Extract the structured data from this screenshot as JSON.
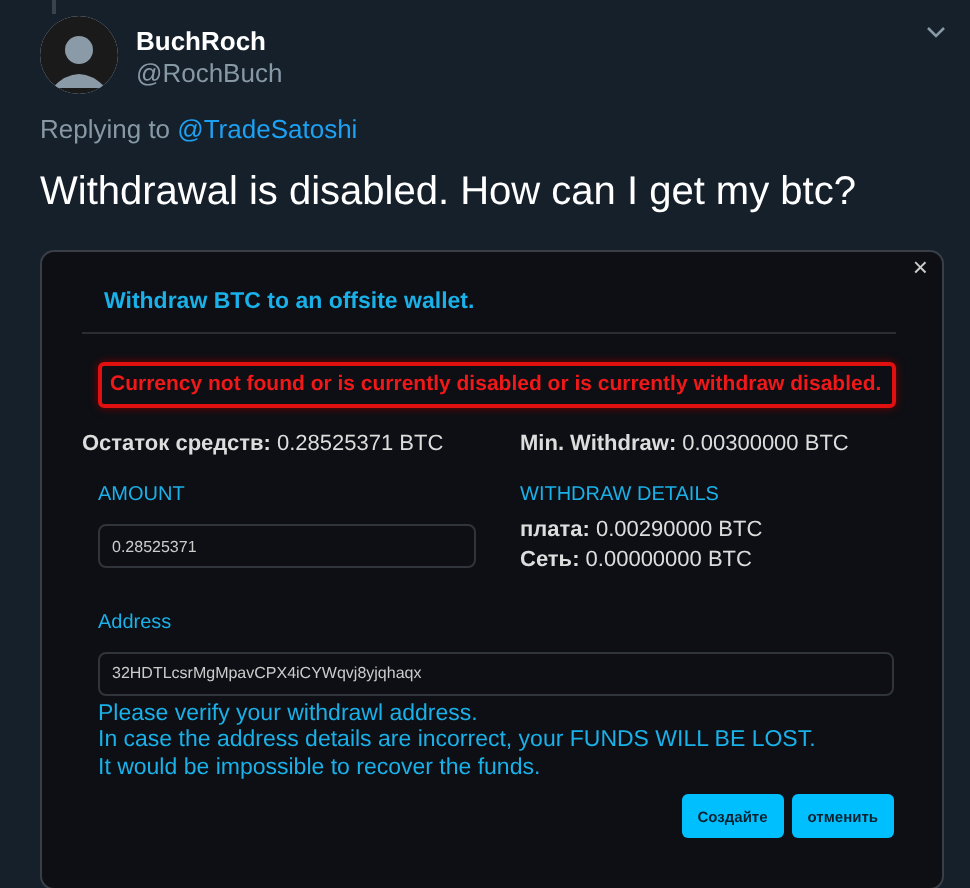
{
  "tweet": {
    "display_name": "BuchRoch",
    "handle": "@RochBuch",
    "replying_prefix": "Replying to",
    "replying_to": "@TradeSatoshi",
    "text": "Withdrawal is disabled. How can I get my btc?"
  },
  "screenshot": {
    "close": "×",
    "title": "Withdraw BTC to an offsite wallet.",
    "error": "Currency not found or is currently disabled or is currently withdraw disabled.",
    "balance": {
      "label": "Остаток средств:",
      "value": "0.28525371 BTC"
    },
    "min_withdraw": {
      "label": "Min. Withdraw:",
      "value": "0.00300000 BTC"
    },
    "amount": {
      "label": "AMOUNT",
      "value": "0.28525371"
    },
    "details": {
      "label": "WITHDRAW DETAILS",
      "rows": [
        {
          "label": "плата:",
          "value": "0.00290000 BTC"
        },
        {
          "label": "Сеть:",
          "value": "0.00000000 BTC"
        }
      ]
    },
    "address": {
      "label": "Address",
      "value": "32HDTLcsrMgMpavCPX4iCYWqvj8yjqhaqx"
    },
    "warnings": [
      "Please verify your withdrawl address.",
      "In case the address details are incorrect, your FUNDS WILL BE LOST.",
      "It would be impossible to recover the funds."
    ],
    "buttons": [
      "Создайте",
      "отменить"
    ]
  }
}
